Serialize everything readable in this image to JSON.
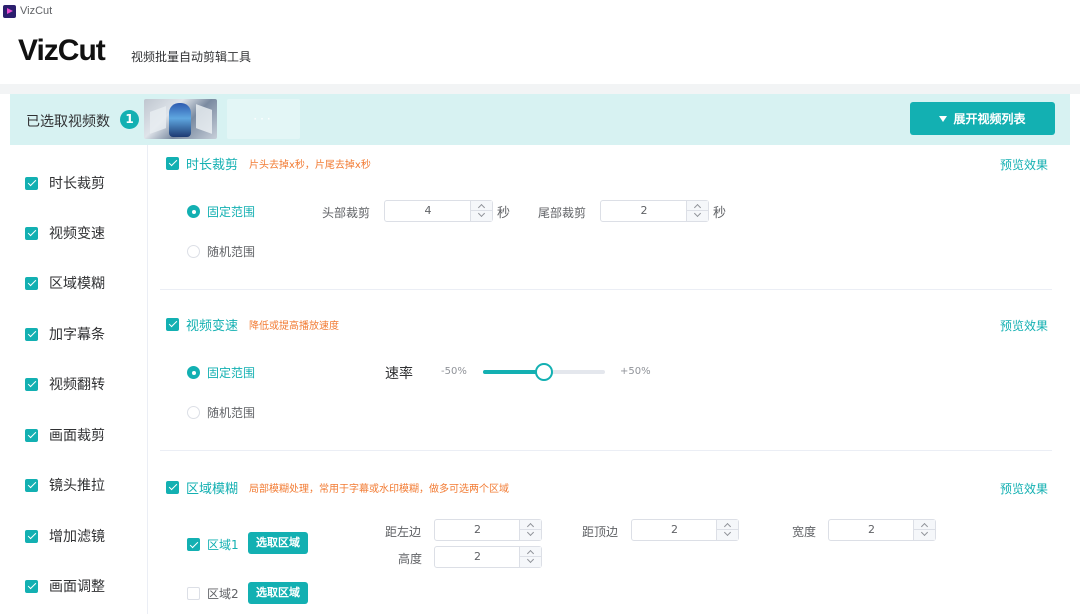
{
  "window": {
    "title": "VizCut"
  },
  "header": {
    "logo": "VizCut",
    "subtitle": "视频批量自动剪辑工具"
  },
  "selection": {
    "label": "已选取视频数",
    "count": "1",
    "more": "···",
    "expand_button": "展开视频列表"
  },
  "sidebar": {
    "items": [
      {
        "label": "时长裁剪",
        "checked": true
      },
      {
        "label": "视频变速",
        "checked": true
      },
      {
        "label": "区域模糊",
        "checked": true
      },
      {
        "label": "加字幕条",
        "checked": true
      },
      {
        "label": "视频翻转",
        "checked": true
      },
      {
        "label": "画面裁剪",
        "checked": true
      },
      {
        "label": "镜头推拉",
        "checked": true
      },
      {
        "label": "增加滤镜",
        "checked": true
      },
      {
        "label": "画面调整",
        "checked": true
      }
    ]
  },
  "duration_trim": {
    "title": "时长裁剪",
    "desc": "片头去掉x秒，片尾去掉x秒",
    "preview": "预览效果",
    "fixed_label": "固定范围",
    "random_label": "随机范围",
    "head_label": "头部裁剪",
    "head_value": "4",
    "head_unit": "秒",
    "tail_label": "尾部裁剪",
    "tail_value": "2",
    "tail_unit": "秒"
  },
  "speed": {
    "title": "视频变速",
    "desc": "降低或提高播放速度",
    "preview": "预览效果",
    "fixed_label": "固定范围",
    "random_label": "随机范围",
    "rate_label": "速率",
    "min_label": "-50%",
    "max_label": "+50%",
    "slider_value": 0.5
  },
  "blur": {
    "title": "区域模糊",
    "desc": "局部模糊处理，常用于字幕或水印模糊，做多可选两个区域",
    "preview": "预览效果",
    "region1_label": "区域1",
    "region2_label": "区域2",
    "pick_button": "选取区域",
    "left_label": "距左边",
    "left_value": "2",
    "top_label": "距顶边",
    "top_value": "2",
    "width_label": "宽度",
    "width_value": "2",
    "height_label": "高度",
    "height_value": "2"
  },
  "colors": {
    "accent": "#13b0b2",
    "desc": "#f27b33",
    "selbar_bg": "#d7f2f2"
  }
}
